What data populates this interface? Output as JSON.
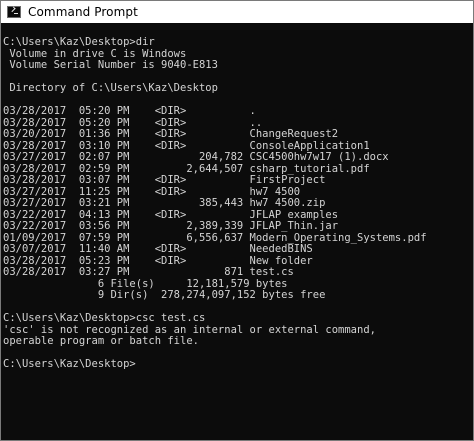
{
  "window": {
    "title": "Command Prompt",
    "icon": "console-icon"
  },
  "console": {
    "lines": [
      "C:\\Users\\Kaz\\Desktop>dir",
      " Volume in drive C is Windows",
      " Volume Serial Number is 9040-E813",
      "",
      " Directory of C:\\Users\\Kaz\\Desktop",
      "",
      "03/28/2017  05:20 PM    <DIR>          .",
      "03/28/2017  05:20 PM    <DIR>          ..",
      "03/20/2017  01:36 PM    <DIR>          ChangeRequest2",
      "03/28/2017  03:10 PM    <DIR>          ConsoleApplication1",
      "03/27/2017  02:07 PM           204,782 CSC4500hw7w17 (1).docx",
      "03/28/2017  02:59 PM         2,644,507 csharp_tutorial.pdf",
      "03/28/2017  03:07 PM    <DIR>          FirstProject",
      "03/27/2017  11:25 PM    <DIR>          hw7 4500",
      "03/27/2017  03:21 PM           385,443 hw7 4500.zip",
      "03/22/2017  04:13 PM    <DIR>          JFLAP examples",
      "03/22/2017  03:56 PM         2,389,339 JFLAP_Thin.jar",
      "01/09/2017  07:59 PM         6,556,637 Modern_Operating_Systems.pdf",
      "03/07/2017  11:40 AM    <DIR>          NeededBINS",
      "03/28/2017  05:23 PM    <DIR>          New folder",
      "03/28/2017  03:27 PM               871 test.cs",
      "               6 File(s)     12,181,579 bytes",
      "               9 Dir(s)  278,274,097,152 bytes free",
      "",
      "C:\\Users\\Kaz\\Desktop>csc test.cs",
      "'csc' is not recognized as an internal or external command,",
      "operable program or batch file.",
      "",
      "C:\\Users\\Kaz\\Desktop>"
    ]
  }
}
